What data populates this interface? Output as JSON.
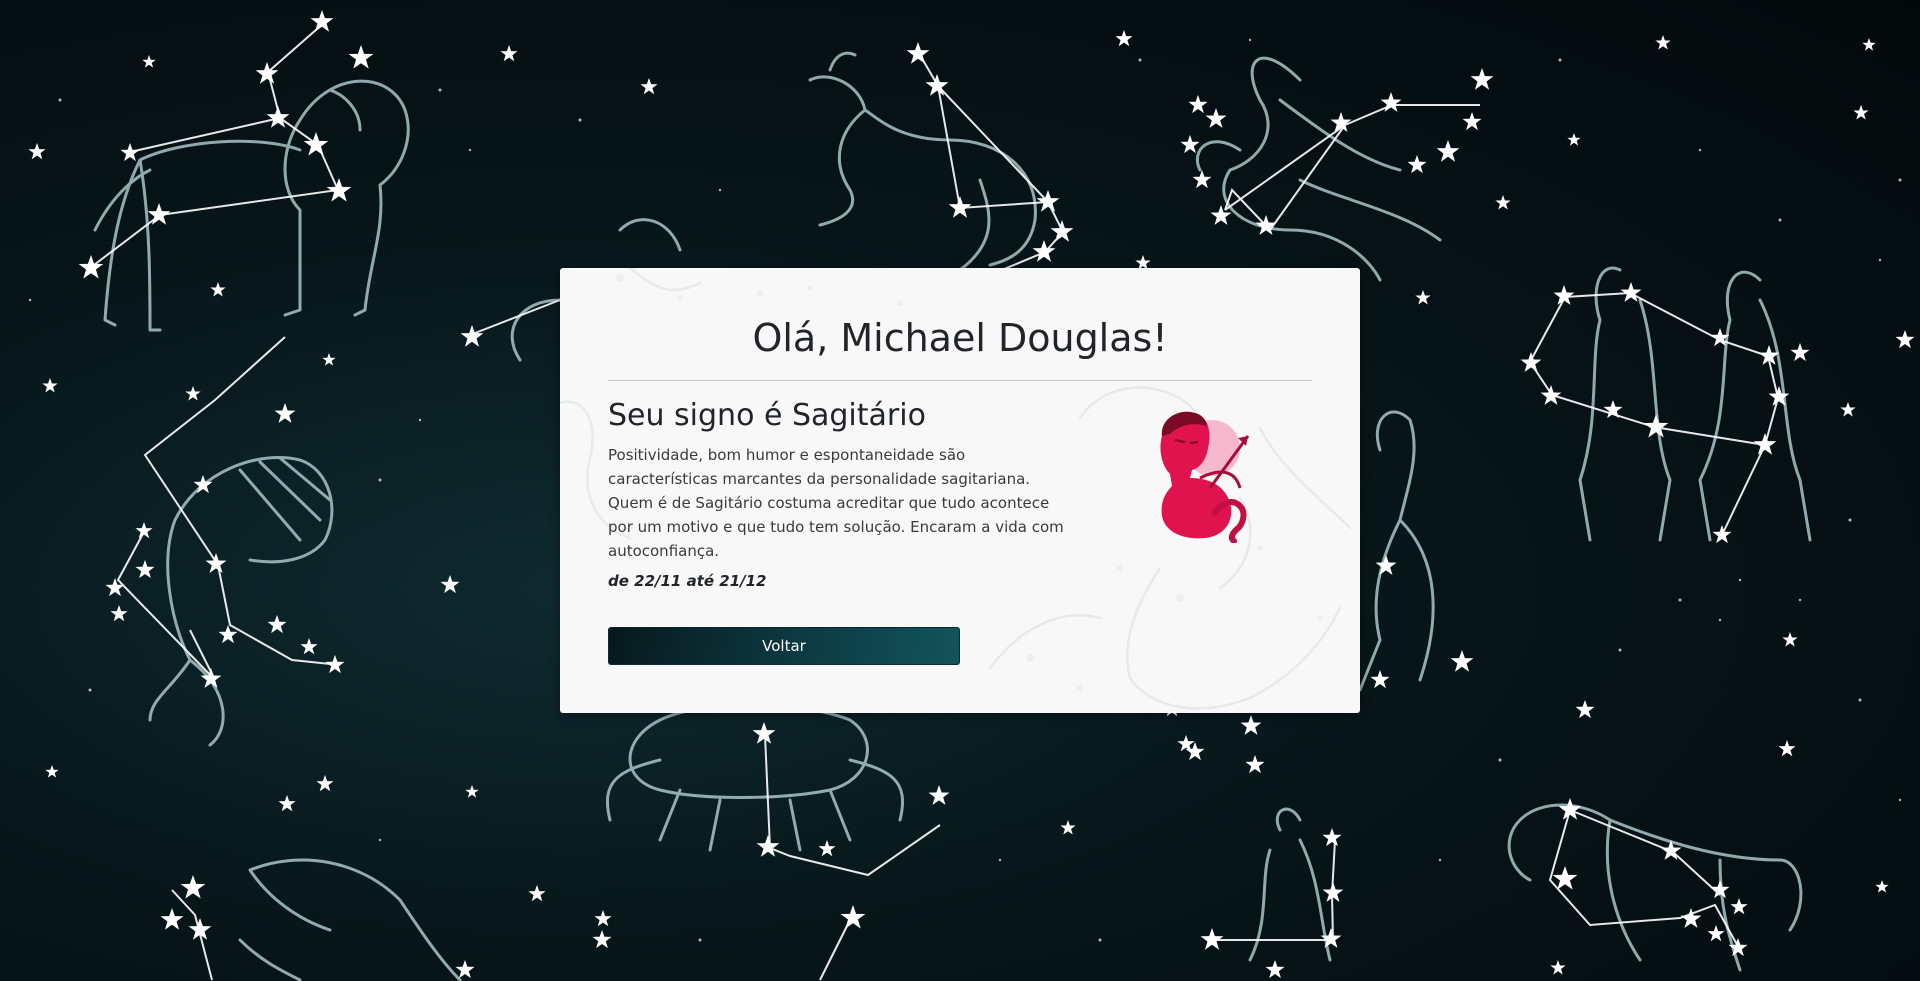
{
  "greeting": "Olá, Michael Douglas!",
  "sign": {
    "title": "Seu signo é Sagitário",
    "description": "Positividade, bom humor e espontaneidade são características marcantes da personalidade sagitariana. Quem é de Sagitário costuma acreditar que tudo acontece por um motivo e que tudo tem solução. Encaram a vida com autoconfiança.",
    "dates": "de 22/11 até 21/12",
    "image_icon": "sagittarius-centaur-icon"
  },
  "actions": {
    "back_label": "Voltar"
  },
  "background": {
    "icon": "zodiac-constellations-background",
    "colors": {
      "sky": "#071519",
      "line": "#a9c4c9",
      "star": "#ffffff"
    }
  },
  "colors": {
    "card": "#f8f8f8",
    "text": "#212529",
    "button": "#0d3a42",
    "sign_accent": "#e0134f"
  }
}
